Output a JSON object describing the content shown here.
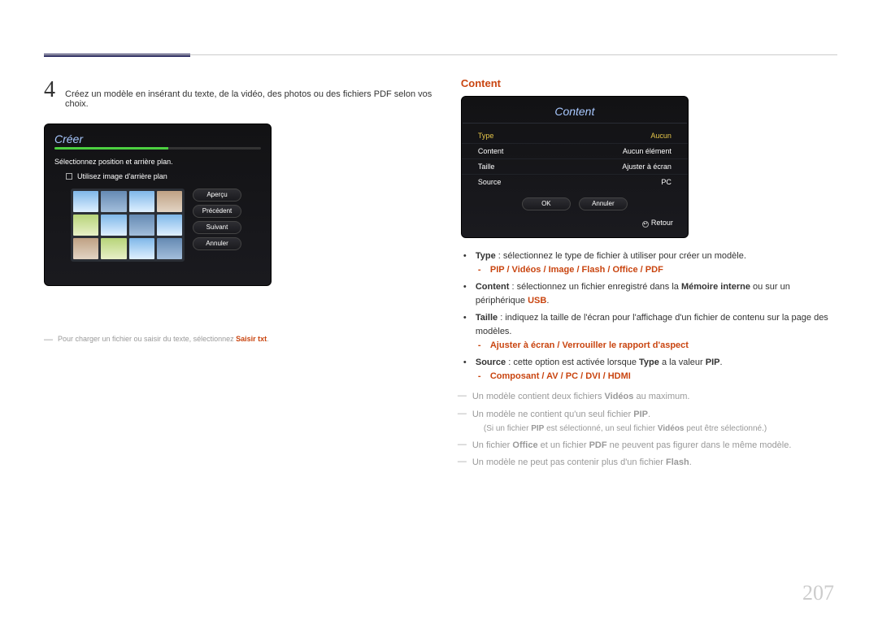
{
  "page_number": "207",
  "step": {
    "num": "4",
    "text": "Créez un modèle en insérant du texte, de la vidéo, des photos ou des fichiers PDF selon vos choix."
  },
  "creer_panel": {
    "title": "Créer",
    "instruction": "Sélectionnez position et arrière plan.",
    "checkbox": "Utilisez image d'arrière plan",
    "buttons": {
      "apercu": "Aperçu",
      "precedent": "Précédent",
      "suivant": "Suivant",
      "annuler": "Annuler"
    }
  },
  "creer_footnote": {
    "prefix": "Pour charger un fichier ou saisir du texte, sélectionnez ",
    "accent": "Saisir txt",
    "suffix": "."
  },
  "content_section": {
    "title": "Content",
    "panel": {
      "title": "Content",
      "rows": [
        {
          "label": "Type",
          "value": "Aucun",
          "hl": true
        },
        {
          "label": "Content",
          "value": "Aucun élément"
        },
        {
          "label": "Taille",
          "value": "Ajuster à écran"
        },
        {
          "label": "Source",
          "value": "PC"
        }
      ],
      "ok": "OK",
      "annuler": "Annuler",
      "retour": "Retour"
    }
  },
  "bullets": {
    "type": {
      "bold": "Type",
      "text": " : sélectionnez le type de fichier à utiliser pour créer un modèle.",
      "sub": "PIP / Vidéos / Image / Flash / Office / PDF"
    },
    "content": {
      "bold": "Content",
      "t1": " : sélectionnez un fichier enregistré dans la ",
      "mem": "Mémoire interne",
      "t2": " ou sur un périphérique ",
      "usb": "USB",
      "t3": "."
    },
    "taille": {
      "bold": "Taille",
      "text": " : indiquez la taille de l'écran pour l'affichage d'un fichier de contenu sur la page des modèles.",
      "sub": "Ajuster à écran / Verrouiller le rapport d'aspect"
    },
    "source": {
      "bold": "Source",
      "t1": " : cette option est activée lorsque ",
      "type": "Type",
      "t2": " a la valeur ",
      "pip": "PIP",
      "t3": ".",
      "sub": "Composant / AV / PC / DVI / HDMI"
    }
  },
  "notes": {
    "n1a": "Un modèle contient deux fichiers ",
    "n1b": "Vidéos",
    "n1c": " au maximum.",
    "n2a": "Un modèle ne contient qu'un seul fichier ",
    "n2b": "PIP",
    "n2c": ".",
    "n2sub_a": "(Si un fichier ",
    "n2sub_b": "PIP",
    "n2sub_c": " est sélectionné, un seul fichier ",
    "n2sub_d": "Vidéos",
    "n2sub_e": " peut être sélectionné.)",
    "n3a": "Un fichier ",
    "n3b": "Office",
    "n3c": " et un fichier ",
    "n3d": "PDF",
    "n3e": " ne peuvent pas figurer dans le même modèle.",
    "n4a": "Un modèle ne peut pas contenir plus d'un fichier ",
    "n4b": "Flash",
    "n4c": "."
  }
}
